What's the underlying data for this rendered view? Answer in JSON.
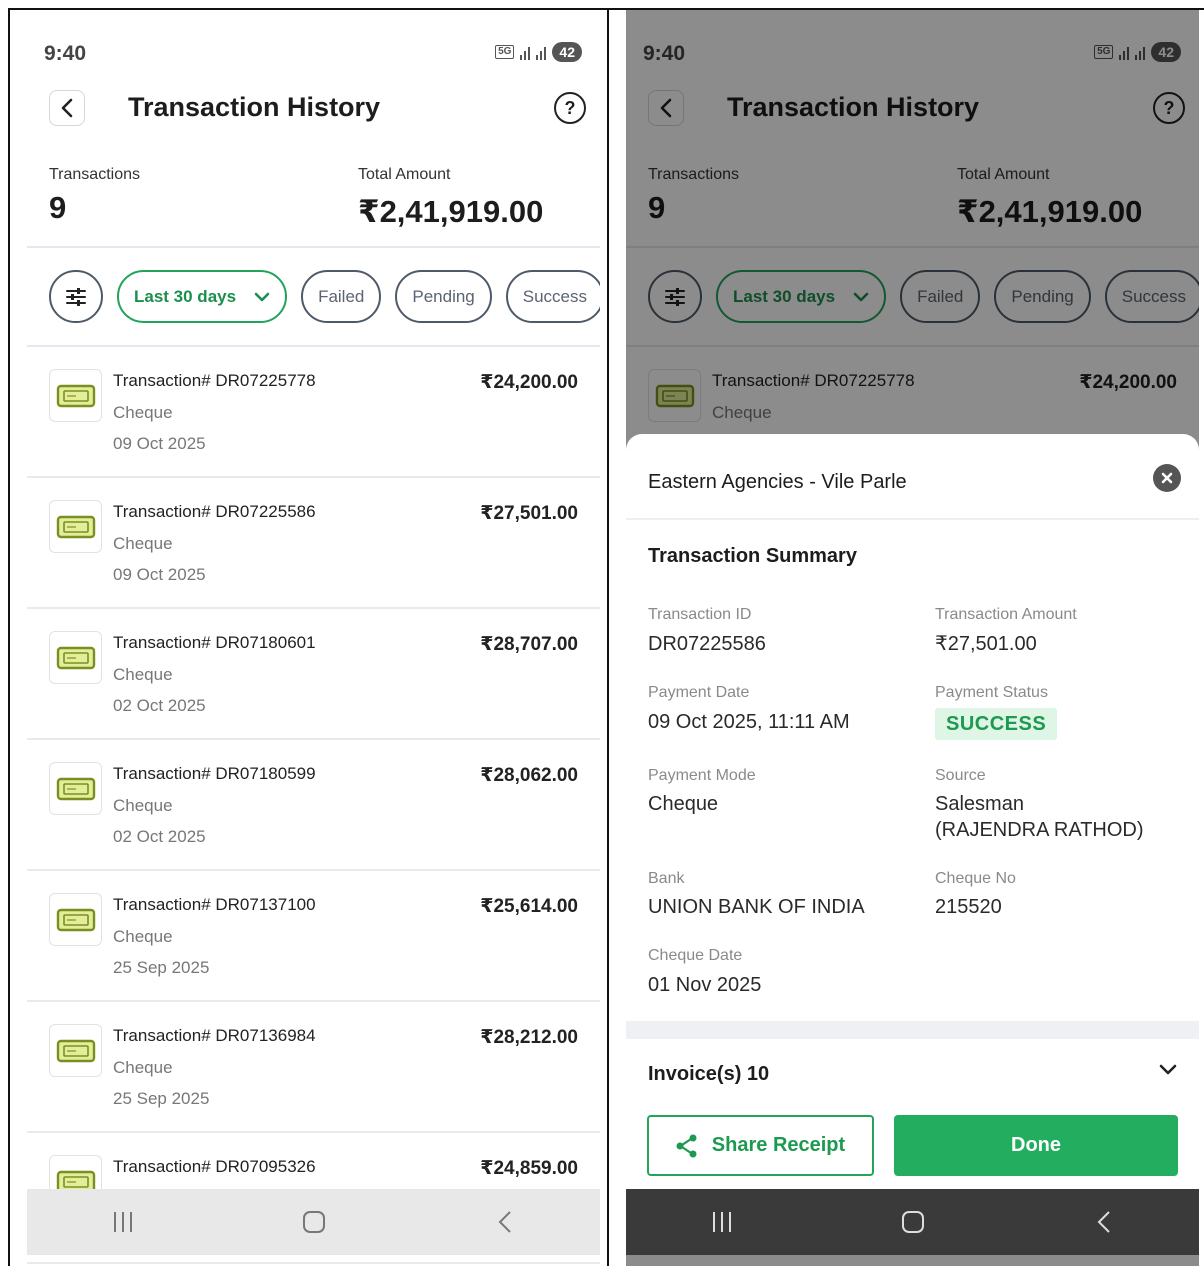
{
  "status_bar": {
    "time": "9:40",
    "network": "5G",
    "battery": "42"
  },
  "header": {
    "title": "Transaction History"
  },
  "summary": {
    "transactions_label": "Transactions",
    "transactions_count": "9",
    "total_label": "Total Amount",
    "total_value": "₹2,41,919.00"
  },
  "filters": {
    "date_range": "Last 30 days",
    "chips": [
      "Failed",
      "Pending",
      "Success"
    ]
  },
  "transactions": [
    {
      "id": "Transaction# DR07225778",
      "amount": "₹24,200.00",
      "mode": "Cheque",
      "date": "09 Oct 2025"
    },
    {
      "id": "Transaction# DR07225586",
      "amount": "₹27,501.00",
      "mode": "Cheque",
      "date": "09 Oct 2025"
    },
    {
      "id": "Transaction# DR07180601",
      "amount": "₹28,707.00",
      "mode": "Cheque",
      "date": "02 Oct 2025"
    },
    {
      "id": "Transaction# DR07180599",
      "amount": "₹28,062.00",
      "mode": "Cheque",
      "date": "02 Oct 2025"
    },
    {
      "id": "Transaction# DR07137100",
      "amount": "₹25,614.00",
      "mode": "Cheque",
      "date": "25 Sep 2025"
    },
    {
      "id": "Transaction# DR07136984",
      "amount": "₹28,212.00",
      "mode": "Cheque",
      "date": "25 Sep 2025"
    },
    {
      "id": "Transaction# DR07095326",
      "amount": "₹24,859.00",
      "mode": "",
      "date": ""
    }
  ],
  "sheet": {
    "title": "Eastern Agencies - Vile Parle",
    "heading": "Transaction Summary",
    "transaction_id_label": "Transaction ID",
    "transaction_id": "DR07225586",
    "amount_label": "Transaction Amount",
    "amount": "₹27,501.00",
    "payment_date_label": "Payment Date",
    "payment_date": "09 Oct 2025, 11:11 AM",
    "payment_status_label": "Payment Status",
    "payment_status": "SUCCESS",
    "payment_mode_label": "Payment Mode",
    "payment_mode": "Cheque",
    "source_label": "Source",
    "source_line1": "Salesman",
    "source_line2": "(RAJENDRA RATHOD)",
    "bank_label": "Bank",
    "bank": "UNION BANK OF INDIA",
    "cheque_no_label": "Cheque No",
    "cheque_no": "215520",
    "cheque_date_label": "Cheque Date",
    "cheque_date": "01 Nov 2025",
    "invoices_label": "Invoice(s) 10",
    "share_label": "Share Receipt",
    "done_label": "Done"
  },
  "icons": {
    "back": "chevron-left-icon",
    "help": "question-circle-icon",
    "filter": "sliders-icon",
    "dropdown": "chevron-down-icon",
    "cheque": "cheque-icon",
    "close": "close-circle-icon",
    "share": "share-icon",
    "nav": [
      "recent-apps-icon",
      "home-icon",
      "back-nav-icon"
    ]
  },
  "colors": {
    "accent": "#22ad5f",
    "success_bg": "#dff5e6",
    "success_text": "#1c9a4f"
  }
}
